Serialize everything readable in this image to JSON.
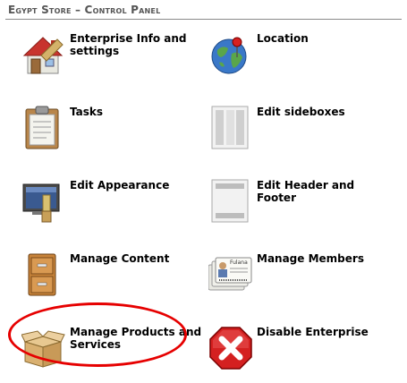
{
  "header": {
    "title": "Egypt Store – Control Panel"
  },
  "items": [
    {
      "label": "Enterprise Info and settings",
      "icon": "house-settings-icon"
    },
    {
      "label": "Location",
      "icon": "globe-pin-icon"
    },
    {
      "label": "Tasks",
      "icon": "clipboard-icon"
    },
    {
      "label": "Edit sideboxes",
      "icon": "sideboxes-layout-icon"
    },
    {
      "label": "Edit Appearance",
      "icon": "paint-brush-icon"
    },
    {
      "label": "Edit Header and Footer",
      "icon": "header-footer-layout-icon"
    },
    {
      "label": "Manage Content",
      "icon": "filing-cabinet-icon"
    },
    {
      "label": "Manage Members",
      "icon": "member-cards-icon",
      "card_name": "Fulana"
    },
    {
      "label": "Manage Products and Services",
      "icon": "open-box-icon"
    },
    {
      "label": "Disable Enterprise",
      "icon": "disable-x-icon"
    }
  ],
  "colors": {
    "highlight": "#e60000",
    "title": "#555555",
    "header_rule": "#8a8a8a"
  }
}
